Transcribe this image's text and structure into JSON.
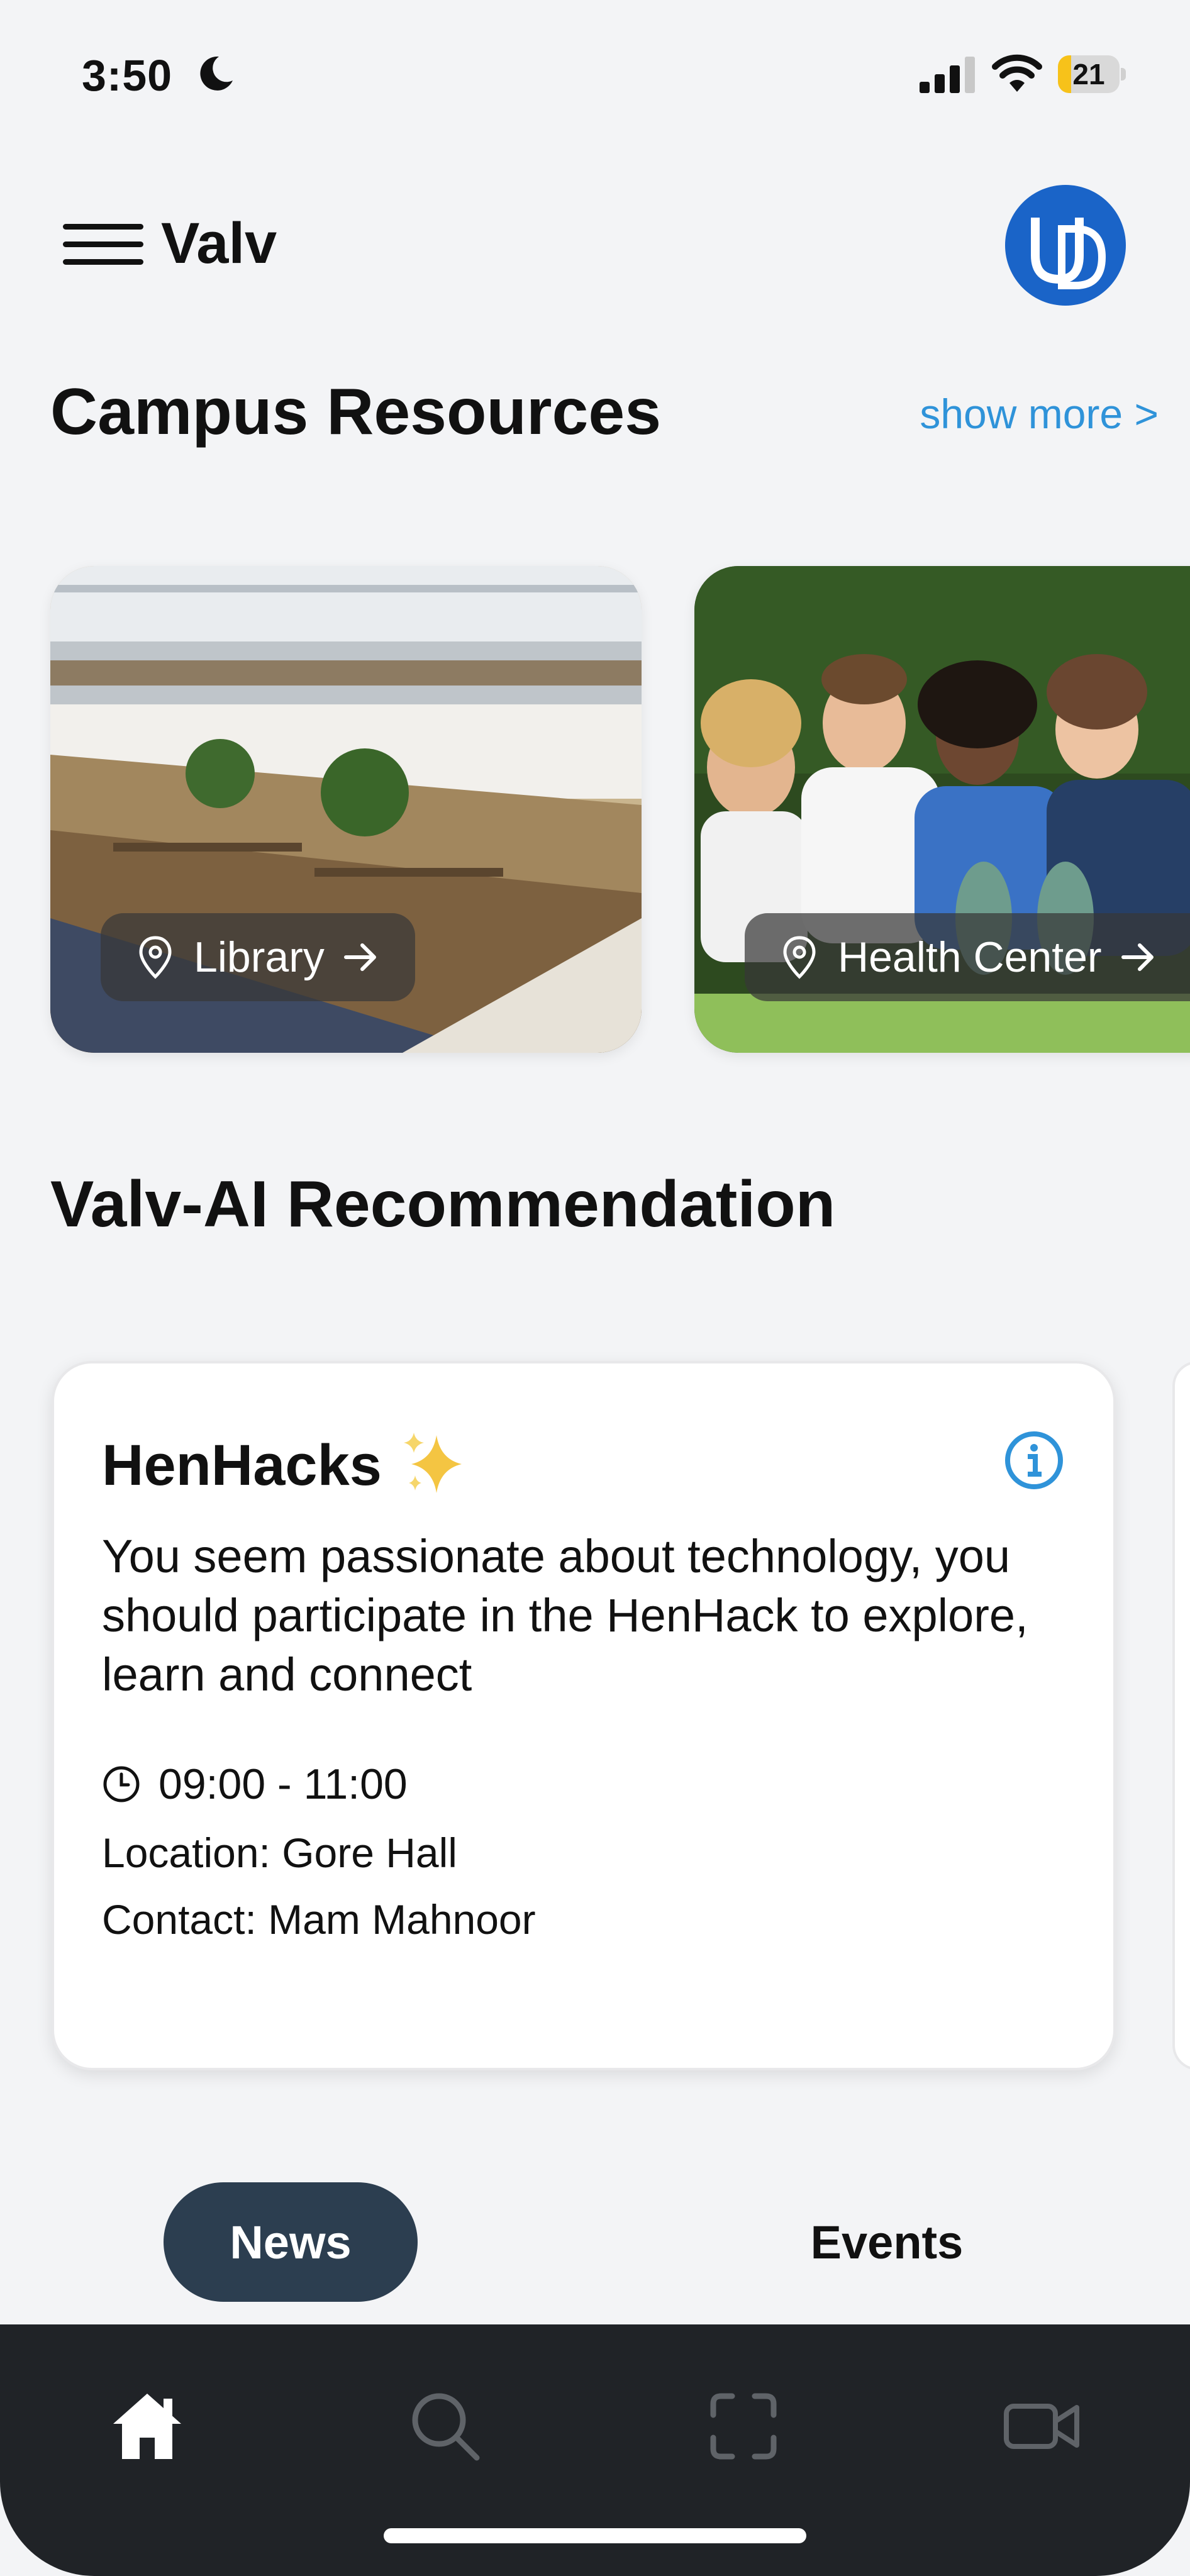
{
  "status_bar": {
    "time": "3:50",
    "battery": "21",
    "battery_level": 0.21,
    "battery_color": "#f7c21a"
  },
  "header": {
    "app_title": "Valv"
  },
  "campus_resources": {
    "title": "Campus Resources",
    "show_more": "show more >",
    "items": [
      {
        "label": "Library"
      },
      {
        "label": "Health Center"
      }
    ]
  },
  "recommendation": {
    "title": "Valv-AI Recommendation",
    "card": {
      "title": "HenHacks",
      "description": "You seem passionate about technology, you should participate in the HenHack to explore, learn and connect",
      "time": "09:00 - 11:00",
      "location": "Location: Gore Hall",
      "contact": "Contact: Mam Mahnoor"
    }
  },
  "tabs": {
    "news": "News",
    "events": "Events",
    "active": "News"
  },
  "bottom_nav": {
    "items": [
      "home-icon",
      "search-icon",
      "scan-icon",
      "video-icon"
    ],
    "active": "home-icon"
  },
  "colors": {
    "accent": "#2f93d9",
    "tab_active": "#2c3e50",
    "nav_bg": "#202327",
    "logo_blue": "#1a64c8"
  }
}
